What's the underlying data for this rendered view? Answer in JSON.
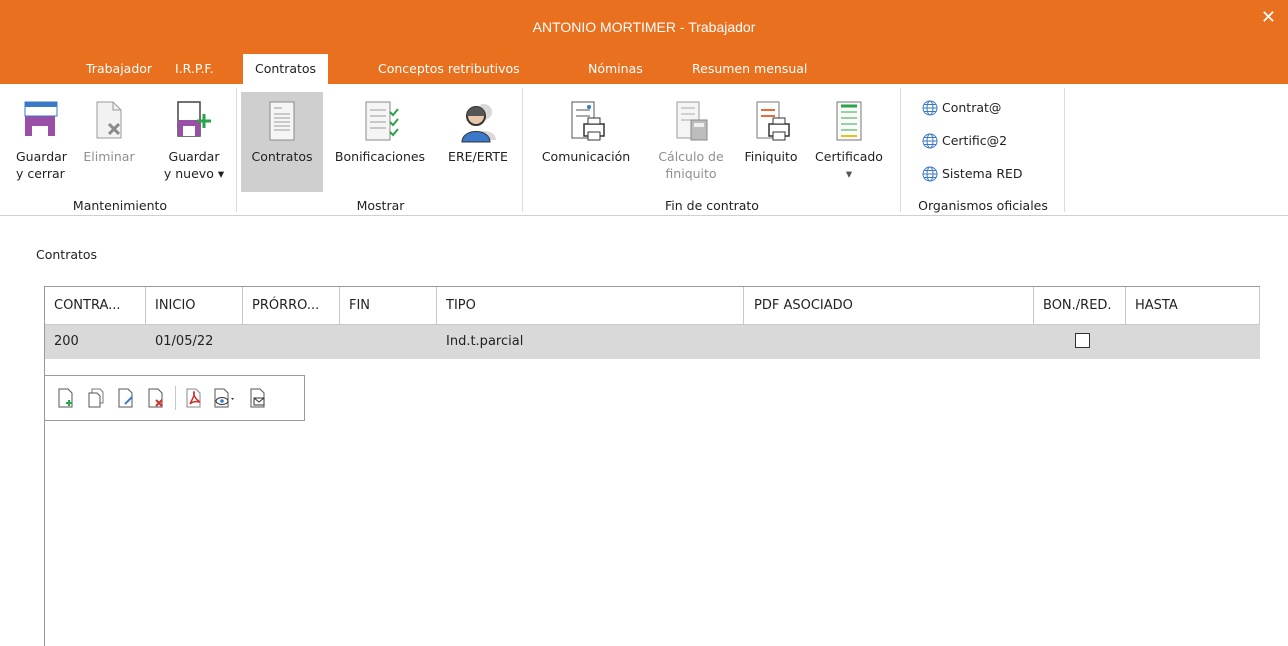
{
  "window": {
    "title": "ANTONIO MORTIMER - Trabajador",
    "close_label": "✕",
    "accent": "#e8701e"
  },
  "tabs": [
    {
      "label": "Trabajador",
      "active": false
    },
    {
      "label": "I.R.P.F.",
      "active": false
    },
    {
      "label": "Contratos",
      "active": true
    },
    {
      "label": "Conceptos retributivos",
      "active": false
    },
    {
      "label": "Nóminas",
      "active": false
    },
    {
      "label": "Resumen mensual",
      "active": false
    }
  ],
  "ribbon": {
    "mantenimiento": {
      "label": "Mantenimiento",
      "guardar_cerrar": [
        "Guardar",
        "y cerrar"
      ],
      "eliminar": "Eliminar",
      "guardar_nuevo": [
        "Guardar",
        "y nuevo ▾"
      ]
    },
    "mostrar": {
      "label": "Mostrar",
      "contratos": "Contratos",
      "bonificaciones": "Bonificaciones",
      "ere_erte": "ERE/ERTE"
    },
    "fin_contrato": {
      "label": "Fin de contrato",
      "comunicacion": "Comunicación",
      "calculo": [
        "Cálculo de",
        "finiquito"
      ],
      "finiquito": "Finiquito",
      "certificado": [
        "Certificado",
        "▾"
      ]
    },
    "organismos": {
      "label": "Organismos oficiales",
      "items": [
        "Contrat@",
        "Certific@2",
        "Sistema RED"
      ]
    }
  },
  "contratos": {
    "section_label": "Contratos",
    "columns": [
      "CONTRA...",
      "INICIO",
      "PRÓRRO...",
      "FIN",
      "TIPO",
      "PDF ASOCIADO",
      "BON./RED.",
      "HASTA"
    ],
    "rows": [
      {
        "contrato": "200",
        "inicio": "01/05/22",
        "prorroga": "",
        "fin": "",
        "tipo": "Ind.t.parcial",
        "pdf": "",
        "bon_red": false,
        "hasta": ""
      }
    ]
  }
}
